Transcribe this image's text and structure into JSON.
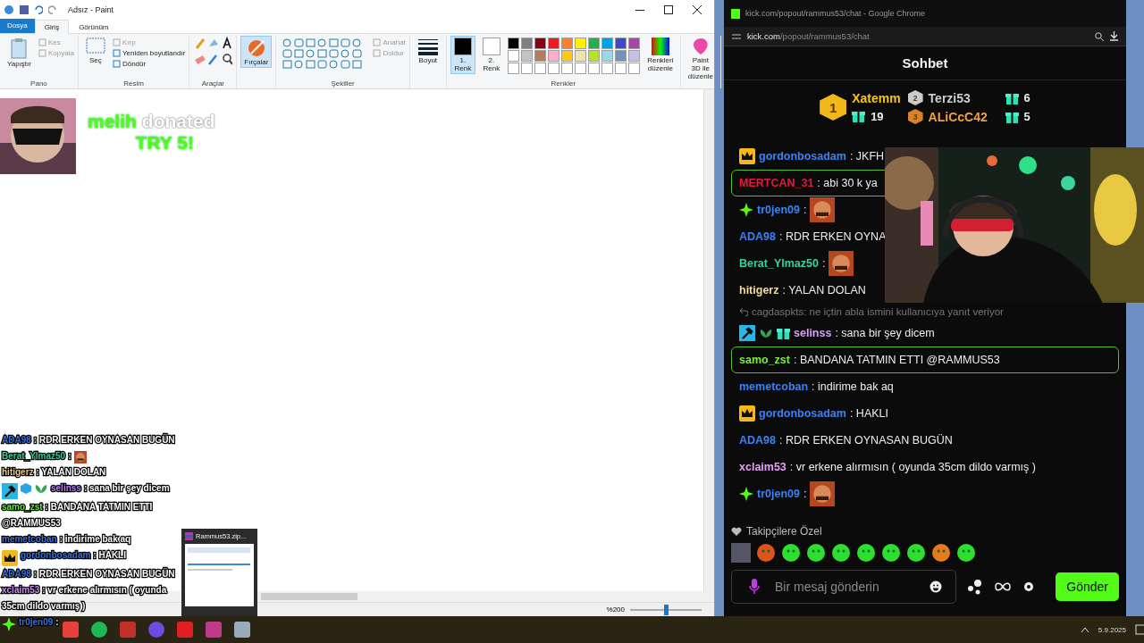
{
  "paint": {
    "title": "Adsız - Paint",
    "file_tab": "Dosya",
    "tabs": [
      {
        "label": "Giriş",
        "selected": true
      },
      {
        "label": "Görünüm",
        "selected": false
      }
    ],
    "groups": [
      {
        "kind": "clipboard",
        "label": "Pano",
        "paste": "Yapıştır",
        "actions": [
          {
            "label": "Kes",
            "disabled": true
          },
          {
            "label": "Kopyala",
            "disabled": true
          }
        ]
      },
      {
        "label": "Resim",
        "select": "Seç",
        "actions": [
          {
            "label": "Kırp",
            "disabled": true
          },
          {
            "label": "Yeniden boyutlandır",
            "disabled": false
          },
          {
            "label": "Döndür",
            "disabled": false
          }
        ]
      },
      {
        "kind": "tools",
        "label": "Araçlar"
      },
      {
        "kind": "brushes",
        "button": "Fırçalar",
        "selected": true
      },
      {
        "kind": "shapes",
        "label": "Şekiller",
        "actions": [
          {
            "label": "Anahat",
            "disabled": true
          },
          {
            "label": "Doldur",
            "disabled": true
          }
        ]
      },
      {
        "kind": "size",
        "button": "Boyut"
      },
      {
        "kind": "colors",
        "label": "Renkler",
        "slots": [
          {
            "label": "1. Renk",
            "selected": true,
            "color": "#000000"
          },
          {
            "label": "2. Renk",
            "selected": false,
            "color": "#ffffff"
          }
        ],
        "palette": [
          {
            "color": "#000000"
          },
          {
            "color": "#7f7f7f"
          },
          {
            "color": "#880015"
          },
          {
            "color": "#ed1c24"
          },
          {
            "color": "#ff7f27"
          },
          {
            "color": "#fff200"
          },
          {
            "color": "#22b14c"
          },
          {
            "color": "#00a2e8"
          },
          {
            "color": "#3f48cc"
          },
          {
            "color": "#a349a4"
          },
          {
            "color": "#ffffff"
          },
          {
            "color": "#c3c3c3"
          },
          {
            "color": "#b97a57"
          },
          {
            "color": "#ffaec9"
          },
          {
            "color": "#ffc90e"
          },
          {
            "color": "#efe4b0"
          },
          {
            "color": "#b5e61d"
          },
          {
            "color": "#99d9ea"
          },
          {
            "color": "#7092be"
          },
          {
            "color": "#c8bfe7"
          }
        ],
        "edit": "Renkleri düzenle"
      },
      {
        "kind": "paint3d",
        "button": "Paint 3D ile düzenle"
      }
    ],
    "zoom": "%200",
    "zoom_slider": {
      "level": 0.5
    }
  },
  "donation": {
    "donor": "melih",
    "verb": "donated",
    "amount": "TRY 5!"
  },
  "overlay_chat": [
    {
      "user": "ADA98",
      "color": "#3b6fd8",
      "text": ": RDR ERKEN OYNASAN BUGÜN"
    },
    {
      "user": "Berat_Ylmaz50",
      "color": "#2fcf9a",
      "text": ":",
      "emote": true
    },
    {
      "user": "hitigerz",
      "color": "#e8c98a",
      "text": ": YALAN DOLAN"
    },
    {
      "user": "selinss",
      "color": "#b77ef0",
      "text": ": sana bir şey dicem",
      "badges": [
        {
          "kind": "hammer"
        },
        {
          "kind": "cube"
        },
        {
          "kind": "sprout"
        }
      ]
    },
    {
      "user": "samo_zst",
      "color": "#5ee83a",
      "text": ": BANDANA TATMIN ETTI @RAMMUS53"
    },
    {
      "user": "memetcoban",
      "color": "#3b6fd8",
      "text": ": indirime bak aq"
    },
    {
      "user": "gordonbosadam",
      "color": "#3b6fd8",
      "text": ": HAKLI",
      "badges": [
        {
          "kind": "crown"
        }
      ]
    },
    {
      "user": "ADA98",
      "color": "#3b6fd8",
      "text": ": RDR ERKEN OYNASAN BUGÜN"
    },
    {
      "user": "xclaim53",
      "color": "#c78bf0",
      "text": ": vr erkene alırmısın ( oyunda 35cm dildo varmış )"
    },
    {
      "user": "tr0jen09",
      "color": "#3b6fd8",
      "text": ":",
      "badges": [
        {
          "kind": "sparkle"
        }
      ]
    }
  ],
  "thumbnail": {
    "title": "Rammus53.zip..."
  },
  "chrome": {
    "title": "kick.com/popout/rammus53/chat - Google Chrome",
    "url_host": "kick.com",
    "url_path": "/popout/rammus53/chat",
    "heading": "Sohbet",
    "leaders": [
      {
        "rank": "1",
        "name": "Xatemm",
        "count": "19"
      },
      {
        "rank": "2",
        "name": "Terzi53",
        "count": "6"
      },
      {
        "rank": "3",
        "name": "ALiCcC42",
        "count": "5"
      }
    ],
    "messages": [
      {
        "kind": "message",
        "user": "gordonbosadam",
        "color": "#3b82f6",
        "text": ": JKFH",
        "badges": [
          {
            "kind": "crown"
          }
        ],
        "highlighted": false
      },
      {
        "kind": "message",
        "user": "MERTCAN_31",
        "color": "#e8173c",
        "text": ": abi 30 k ya",
        "highlighted": true
      },
      {
        "kind": "message",
        "user": "tr0jen09",
        "color": "#3b82f6",
        "text": ":",
        "badges": [
          {
            "kind": "sparkle"
          }
        ],
        "emote": true,
        "highlighted": false
      },
      {
        "kind": "message",
        "user": "ADA98",
        "color": "#3b82f6",
        "text": ": RDR ERKEN OYNA",
        "highlighted": false
      },
      {
        "kind": "message",
        "user": "Berat_Ylmaz50",
        "color": "#34d399",
        "text": ":",
        "emote": true,
        "highlighted": false
      },
      {
        "kind": "message",
        "user": "hitigerz",
        "color": "#f3d89a",
        "text": ": YALAN DOLAN",
        "highlighted": false
      },
      {
        "kind": "reply",
        "user": "cagdaspkts",
        "text": ": ne içtin abla ismini kullanıcıya yanıt veriyor"
      },
      {
        "kind": "message",
        "user": "selinss",
        "color": "#d8a0f5",
        "text": ": sana bir şey dicem",
        "badges": [
          {
            "kind": "hammer"
          },
          {
            "kind": "sprout"
          },
          {
            "kind": "gift"
          }
        ],
        "highlighted": false
      },
      {
        "kind": "message",
        "user": "samo_zst",
        "color": "#7bea3b",
        "text": ": BANDANA TATMIN ETTI @RAMMUS53",
        "highlighted": true
      },
      {
        "kind": "message",
        "user": "memetcoban",
        "color": "#3b82f6",
        "text": ": indirime bak aq",
        "highlighted": false
      },
      {
        "kind": "message",
        "user": "gordonbosadam",
        "color": "#3b82f6",
        "text": ": HAKLI",
        "badges": [
          {
            "kind": "crown"
          }
        ],
        "highlighted": false
      },
      {
        "kind": "message",
        "user": "ADA98",
        "color": "#3b82f6",
        "text": ": RDR ERKEN OYNASAN BUGÜN",
        "highlighted": false
      },
      {
        "kind": "message",
        "user": "xclaim53",
        "color": "#e5a0f5",
        "text": ": vr erkene alırmısın ( oyunda 35cm dildo varmış )",
        "highlighted": false
      },
      {
        "kind": "message",
        "user": "tr0jen09",
        "color": "#3b82f6",
        "text": ":",
        "badges": [
          {
            "kind": "sparkle"
          }
        ],
        "emote": true,
        "highlighted": false
      }
    ],
    "followers_only": "Takipçilere Özel",
    "input": {
      "placeholder": "Bir mesaj gönderin"
    },
    "send": "Gönder"
  },
  "taskbar": {
    "date": "5.9.2025"
  }
}
